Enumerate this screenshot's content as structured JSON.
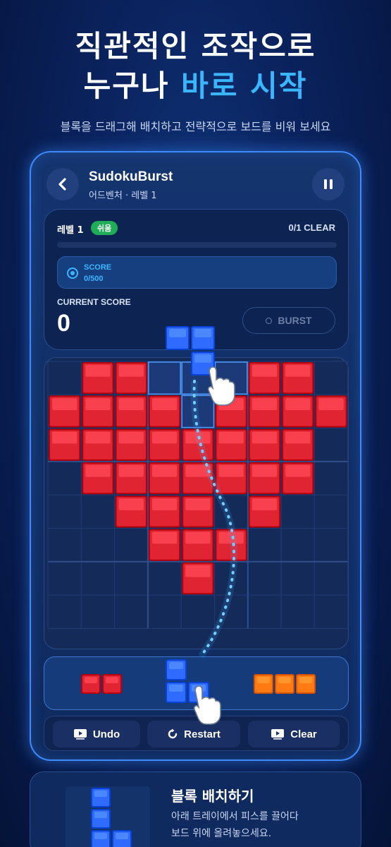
{
  "headline": {
    "line1": "직관적인 조작으로",
    "line2_plain": "누구나 ",
    "line2_accent": "바로 시작"
  },
  "subtitle": "블록을 드래그해 배치하고 전략적으로 보드를 비워 보세요",
  "app": {
    "title": "SudokuBurst",
    "subtitle": "어드벤처 · 레벨 1",
    "back_icon": "chevron-left-icon",
    "pause_icon": "pause-icon"
  },
  "status": {
    "level_label": "레벨 1",
    "difficulty": "쉬움",
    "clear_count": "0/1 CLEAR",
    "progress": 0,
    "score_label": "SCORE",
    "score_value": "0/500",
    "current_score_label": "CURRENT SCORE",
    "current_score": "0",
    "burst_label": "BURST"
  },
  "board": {
    "columns": 9,
    "rows": 8,
    "filled_cells": [
      [
        0,
        1
      ],
      [
        0,
        2
      ],
      [
        0,
        6
      ],
      [
        0,
        7
      ],
      [
        1,
        0
      ],
      [
        1,
        1
      ],
      [
        1,
        2
      ],
      [
        1,
        3
      ],
      [
        1,
        5
      ],
      [
        1,
        6
      ],
      [
        1,
        7
      ],
      [
        1,
        8
      ],
      [
        2,
        0
      ],
      [
        2,
        1
      ],
      [
        2,
        2
      ],
      [
        2,
        3
      ],
      [
        2,
        4
      ],
      [
        2,
        5
      ],
      [
        2,
        6
      ],
      [
        2,
        7
      ],
      [
        3,
        1
      ],
      [
        3,
        2
      ],
      [
        3,
        3
      ],
      [
        3,
        4
      ],
      [
        3,
        5
      ],
      [
        3,
        6
      ],
      [
        3,
        7
      ],
      [
        4,
        2
      ],
      [
        4,
        3
      ],
      [
        4,
        4
      ],
      [
        4,
        6
      ],
      [
        5,
        3
      ],
      [
        5,
        4
      ],
      [
        5,
        5
      ],
      [
        6,
        4
      ]
    ],
    "target_cells": [
      [
        0,
        3
      ],
      [
        0,
        4
      ],
      [
        0,
        5
      ],
      [
        1,
        4
      ]
    ]
  },
  "tray": {
    "pieces": [
      {
        "name": "red-bar",
        "color": "#e02432",
        "cells": 2
      },
      {
        "name": "blue-l",
        "color": "#2f6bff",
        "cells": 3
      },
      {
        "name": "orange-bar",
        "color": "#ff7a12",
        "cells": 3
      }
    ]
  },
  "actions": {
    "undo": "Undo",
    "restart": "Restart",
    "clear": "Clear"
  },
  "tip": {
    "title": "블록 배치하기",
    "line1": "아래 트레이에서 피스를 끌어다",
    "line2": "보드 위에 올려놓으세요."
  },
  "colors": {
    "accent": "#3ab6ff",
    "red_block": "#e02432",
    "blue_block": "#2f6bff",
    "orange_block": "#ff7a12",
    "badge_green": "#1fae57"
  }
}
